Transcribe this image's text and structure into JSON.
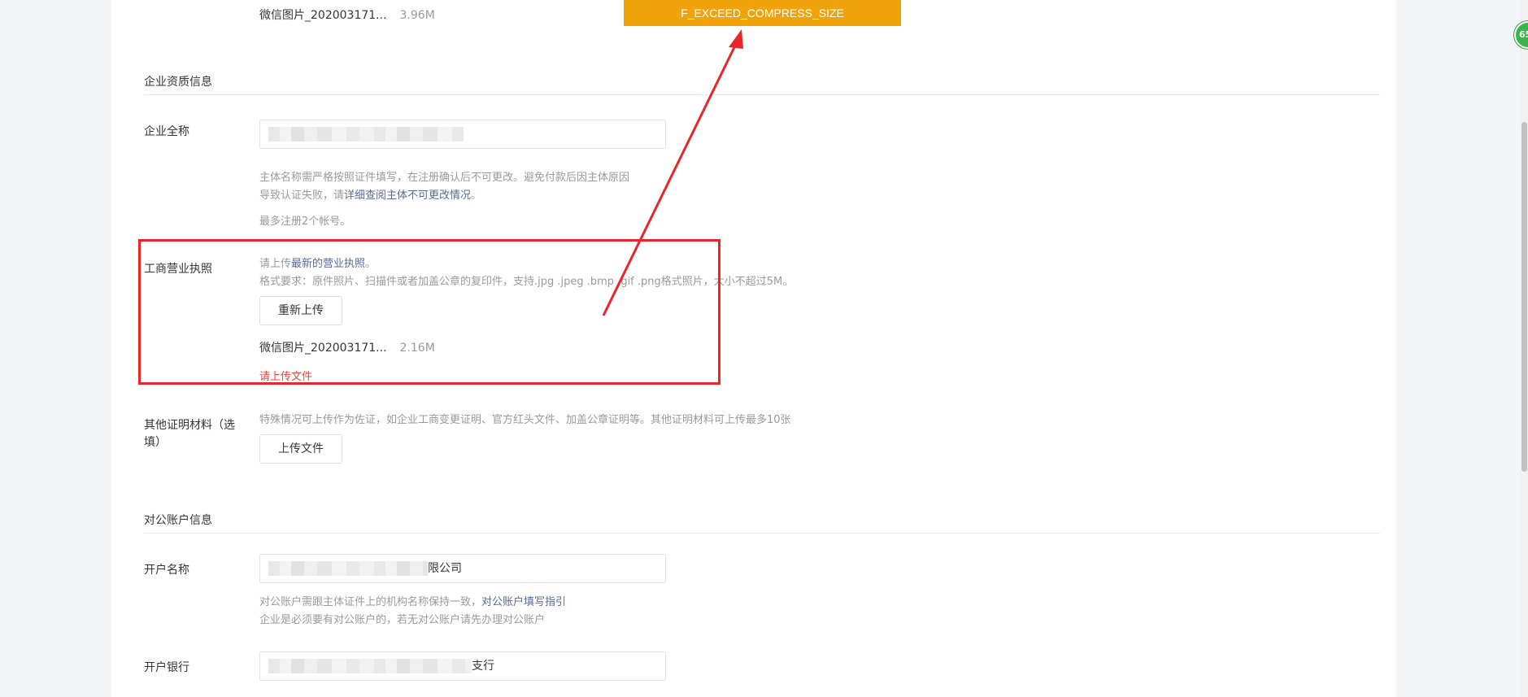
{
  "top_file": {
    "name": "微信图片_202003171...",
    "size": "3.96M"
  },
  "toast": {
    "message": "F_EXCEED_COMPRESS_SIZE"
  },
  "qualification": {
    "section_title": "企业资质信息",
    "company_name": {
      "label": "企业全称",
      "tip_prefix": "主体名称需严格按照证件填写，在注册确认后不可更改。避免付款后因主体原因",
      "tip_line2_prefix": "导致认证失败，请",
      "tip_link": "详细查阅主体不可更改情况",
      "tip_line2_suffix": "。",
      "limit_tip": "最多注册2个帐号。"
    },
    "business_license": {
      "label": "工商营业执照",
      "tip_prefix": "请上传",
      "tip_link": "最新的营业执照",
      "tip_suffix": "。",
      "format_tip": "格式要求：原件照片、扫描件或者加盖公章的复印件，支持.jpg .jpeg .bmp .gif .png格式照片，大小不超过5M。",
      "reupload_label": "重新上传",
      "file_name": "微信图片_202003171...",
      "file_size": "2.16M",
      "error": "请上传文件"
    },
    "other_materials": {
      "label_line1": "其他证明材料（选",
      "label_line2": "填）",
      "tip": "特殊情况可上传作为佐证，如企业工商变更证明、官方红头文件、加盖公章证明等。其他证明材料可上传最多10张",
      "upload_label": "上传文件"
    }
  },
  "bank_account": {
    "section_title": "对公账户信息",
    "account_name": {
      "label": "开户名称",
      "value_suffix": "限公司",
      "tip_prefix": "对公账户需跟主体证件上的机构名称保持一致，",
      "tip_link": "对公账户填写指引",
      "tip_line2": "企业是必须要有对公账户的，若无对公账户请先办理对公账户"
    },
    "bank": {
      "label": "开户银行",
      "value_suffix": "支行"
    }
  },
  "badge": {
    "text": "65"
  },
  "colors": {
    "toast": "#f0a30a",
    "highlight": "#e8262b",
    "error": "#e64340",
    "link": "#576b95"
  }
}
